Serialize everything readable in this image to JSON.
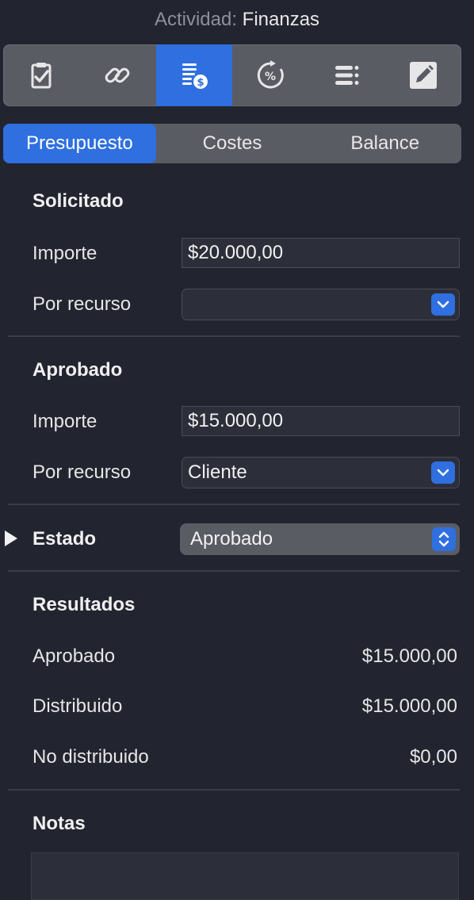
{
  "header": {
    "prefix": "Actividad:",
    "title": "Finanzas"
  },
  "toolbar": {
    "icons": [
      "clipboard-check-icon",
      "link-icon",
      "finance-coins-icon",
      "percent-cycle-icon",
      "list-icon",
      "edit-pencil-icon"
    ],
    "active_index": 2
  },
  "tabs": [
    "Presupuesto",
    "Costes",
    "Balance"
  ],
  "solicitado": {
    "title": "Solicitado",
    "importe_label": "Importe",
    "importe_value": "$20.000,00",
    "recurso_label": "Por recurso",
    "recurso_value": ""
  },
  "aprobado": {
    "title": "Aprobado",
    "importe_label": "Importe",
    "importe_value": "$15.000,00",
    "recurso_label": "Por recurso",
    "recurso_value": "Cliente"
  },
  "estado": {
    "label": "Estado",
    "value": "Aprobado"
  },
  "resultados": {
    "title": "Resultados",
    "rows": [
      {
        "label": "Aprobado",
        "value": "$15.000,00"
      },
      {
        "label": "Distribuido",
        "value": "$15.000,00"
      },
      {
        "label": "No distribuido",
        "value": "$0,00"
      }
    ]
  },
  "notas": {
    "title": "Notas"
  },
  "colors": {
    "accent": "#2f6fe0",
    "background": "#22252f"
  }
}
